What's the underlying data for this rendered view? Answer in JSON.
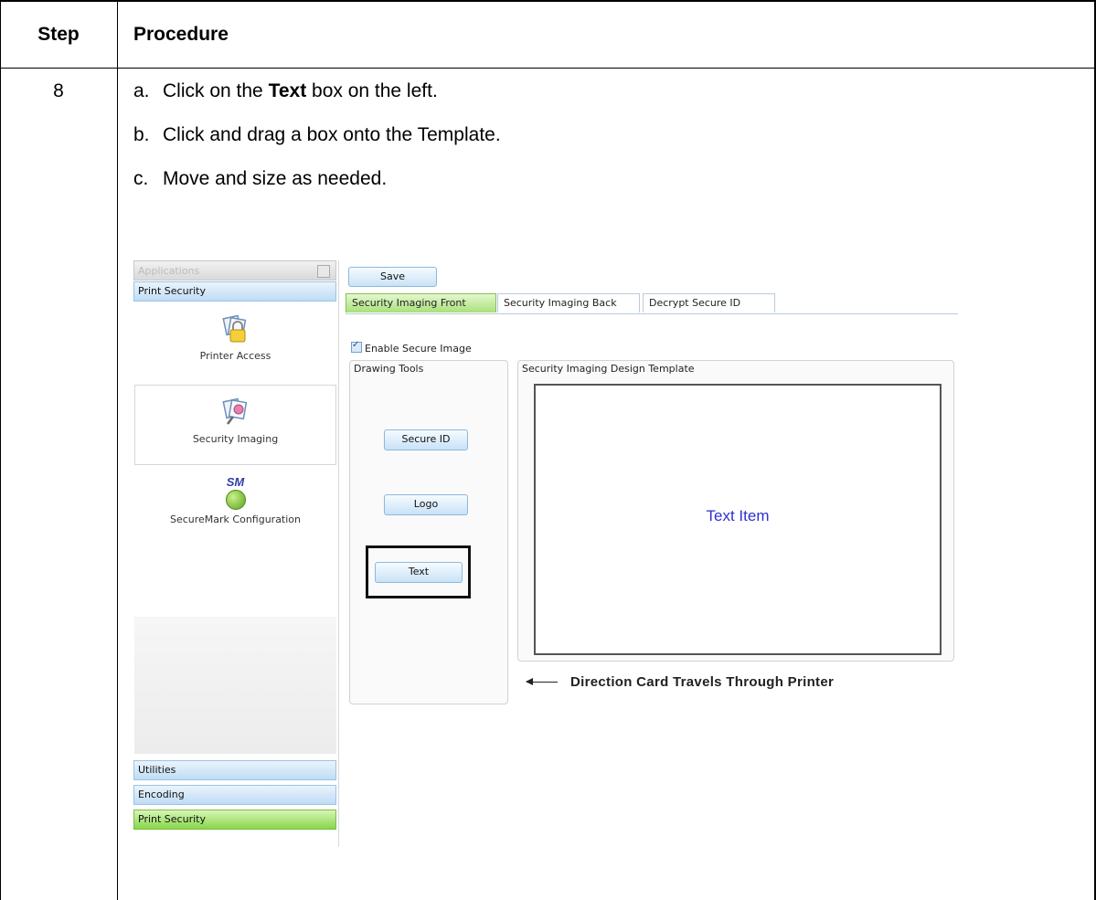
{
  "table": {
    "header_step": "Step",
    "header_procedure": "Procedure",
    "step_number": "8",
    "instructions": [
      {
        "label": "a.",
        "before": "Click on the ",
        "bold": "Text",
        "after": " box on the left."
      },
      {
        "label": "b.",
        "before": "Click and drag a box onto the Template.",
        "bold": "",
        "after": ""
      },
      {
        "label": "c.",
        "before": "Move and size as needed.",
        "bold": "",
        "after": ""
      }
    ]
  },
  "app": {
    "sidebar": {
      "header": "Applications",
      "top_category": "Print Security",
      "items": [
        {
          "label": "Printer Access",
          "icon": "printer-access-lock-icon"
        },
        {
          "label": "Security Imaging",
          "icon": "security-imaging-icon"
        },
        {
          "label": "SecureMark Configuration",
          "icon": "securemark-icon",
          "icon_text": "SM"
        }
      ],
      "bottom_categories": [
        "Utilities",
        "Encoding",
        "Print Security"
      ]
    },
    "toolbar": {
      "save_label": "Save"
    },
    "tabs": [
      "Security Imaging Front",
      "Security Imaging Back",
      "Decrypt Secure ID"
    ],
    "enable_secure_image": {
      "label": "Enable Secure Image",
      "checked": true
    },
    "drawing_tools": {
      "title": "Drawing Tools",
      "buttons": [
        "Secure ID",
        "Logo",
        "Text"
      ]
    },
    "template": {
      "title": "Security Imaging Design Template",
      "text_item": "Text Item"
    },
    "direction_label": "Direction Card Travels Through Printer"
  },
  "colors": {
    "tab_active": "#a9e07a",
    "category_blue": "#bfdcf5",
    "category_green": "#88d64a",
    "text_item": "#3030d0"
  }
}
